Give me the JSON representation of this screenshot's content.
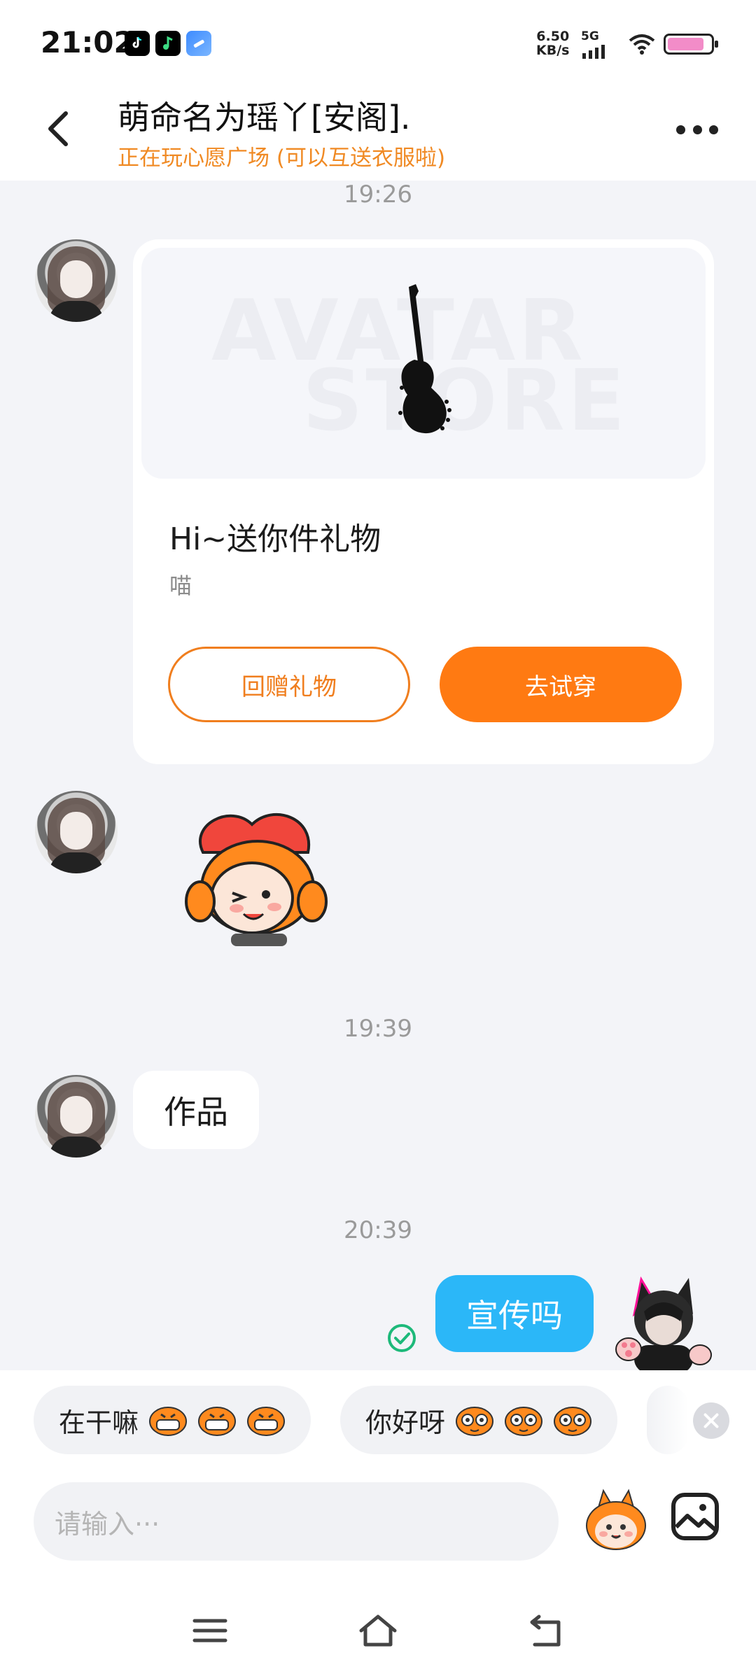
{
  "status_bar": {
    "time": "21:02",
    "net_speed_value": "6.50",
    "net_speed_unit": "KB/s",
    "network": "5G",
    "battery_percent": 85
  },
  "header": {
    "title": "萌命名为瑶丫[安阁].",
    "subtitle": "正在玩心愿广场 (可以互送衣服啦)"
  },
  "messages": {
    "time_1": "19:26",
    "gift_card": {
      "watermark_top": "AVATAR",
      "watermark_bottom": "STORE",
      "title": "Hi~送你件礼物",
      "description": "喵",
      "return_gift_label": "回赠礼物",
      "try_on_label": "去试穿"
    },
    "time_2": "19:39",
    "text_in": "作品",
    "time_3": "20:39",
    "text_out": "宣传吗"
  },
  "quick_replies": [
    {
      "text": "在干嘛"
    },
    {
      "text": "你好呀"
    }
  ],
  "input": {
    "placeholder": "请输入···"
  },
  "colors": {
    "accent_orange": "#FF7A12",
    "subtitle_orange": "#F08A24",
    "bubble_blue": "#2BB7F8",
    "check_green": "#1DB97A"
  },
  "icons": {
    "back": "chevron-left-icon",
    "more": "more-dots-icon",
    "emoji": "emoji-mascot-icon",
    "image": "image-icon",
    "close": "close-icon",
    "nav_menu": "menu-icon",
    "nav_home": "home-icon",
    "nav_back": "back-icon"
  }
}
